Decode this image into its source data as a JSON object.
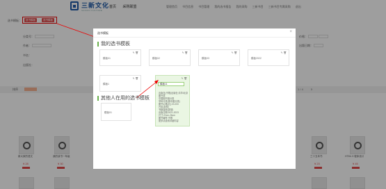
{
  "header": {
    "logo_text": "三新文化",
    "logo_sub": "SANXIN CULTURE",
    "nav_main": [
      "首页",
      "采购联盟"
    ],
    "nav_right": [
      "管理首页",
      "书目信息",
      "书目管理",
      "我的选书报告",
      "我的采购",
      "三新书目",
      "三新书目专属采购",
      "退出"
    ]
  },
  "background": {
    "buttons": [
      "选书模板",
      "选书模板"
    ],
    "label": "选书模板：",
    "filter_labels": [
      "分类号：",
      "作者：",
      "书名：",
      "出版社：",
      "价格：",
      "出版日期："
    ],
    "strip_label": "排序",
    "pager": [
      "1",
      "/",
      "4",
      "5"
    ],
    "books": [
      {
        "title": "新大家的语文",
        "price": "¥ 28"
      },
      {
        "title": "我的读书一年级",
        "price": "¥ 30"
      },
      {
        "title": "三十五本书",
        "price": "¥ 23"
      },
      {
        "title": "HTML 5 程序设计",
        "price": "¥ 45"
      }
    ]
  },
  "modal": {
    "title": "选书模板",
    "close": "×",
    "my_templates_title": "我的选书模板",
    "others_templates_title": "其他人在用的选书模板",
    "my_cards": [
      {
        "name": "模板01"
      },
      {
        "name": "模板02"
      },
      {
        "name": "模板03"
      },
      {
        "name": "模板2022"
      },
      {
        "name": "模板1"
      },
      {
        "name": "模板11"
      }
    ],
    "others_cards": [
      {
        "name": "模板01"
      }
    ],
    "card_actions": "✎ 🗑",
    "edit_value": "模板11",
    "detail_lines": [
      "出版社(不限)出版社:清华/北京",
      "图书类",
      "中国图书馆分类",
      "学科分类(按中图分类)",
      "图书价格(元):20-200",
      "开本(类型)",
      "书籍装帧(类型)",
      "出版日期:2021-2023",
      "尺寸:22cm-26cm",
      "图书编号:不限",
      "更多请查看详细内容"
    ]
  },
  "colors": {
    "accent": "#e04b4b",
    "brand": "#1e5aa8",
    "green": "#6ab04c"
  }
}
